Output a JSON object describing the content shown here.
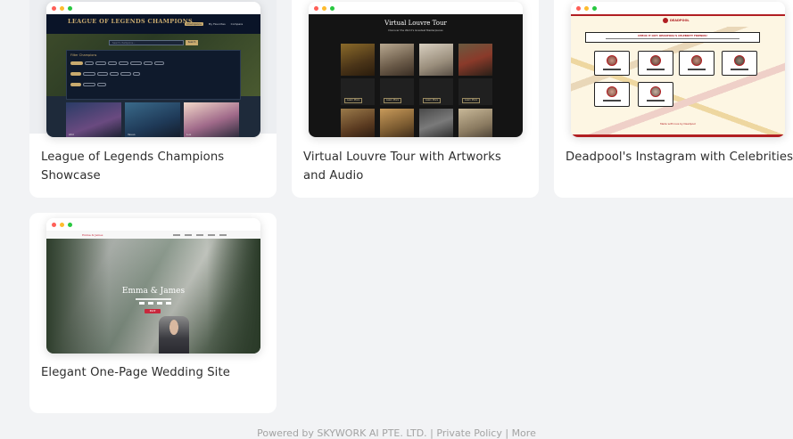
{
  "cards": [
    {
      "title": "League of Legends Champions Showcase",
      "preview": {
        "heading": "LEAGUE OF LEGENDS CHAMPIONS",
        "nav": [
          "Champions",
          "My Favorites",
          "Compare"
        ],
        "search_placeholder": "Search champions...",
        "search_button": "Search",
        "filter_title": "Filter Champions",
        "champions": [
          "Ahri",
          "Yasuo",
          "Lux"
        ],
        "accent_color": "#c8aa6e"
      }
    },
    {
      "title": "Virtual Louvre Tour with Artworks and Audio",
      "preview": {
        "heading": "Virtual Louvre Tour",
        "subheading": "Discover the World's Greatest Masterpieces",
        "button_label": "Learn More"
      }
    },
    {
      "title": "Deadpool's Instagram with Celebrities",
      "preview": {
        "brand": "DEADPOOL",
        "banner": "CHECK IT OUT: DEADPOOL'S CELEBRITY FRIENDS!",
        "footer_text": "Made with love by Deadpool",
        "accent_color": "#b11e22"
      }
    },
    {
      "title": "Elegant One-Page Wedding Site",
      "preview": {
        "couple": "Emma & James",
        "brand": "Emma & James",
        "button_label": "RSVP",
        "accent_color": "#c8283c"
      }
    }
  ],
  "footer": "Powered by SKYWORK AI PTE. LTD. | Private Policy | More"
}
